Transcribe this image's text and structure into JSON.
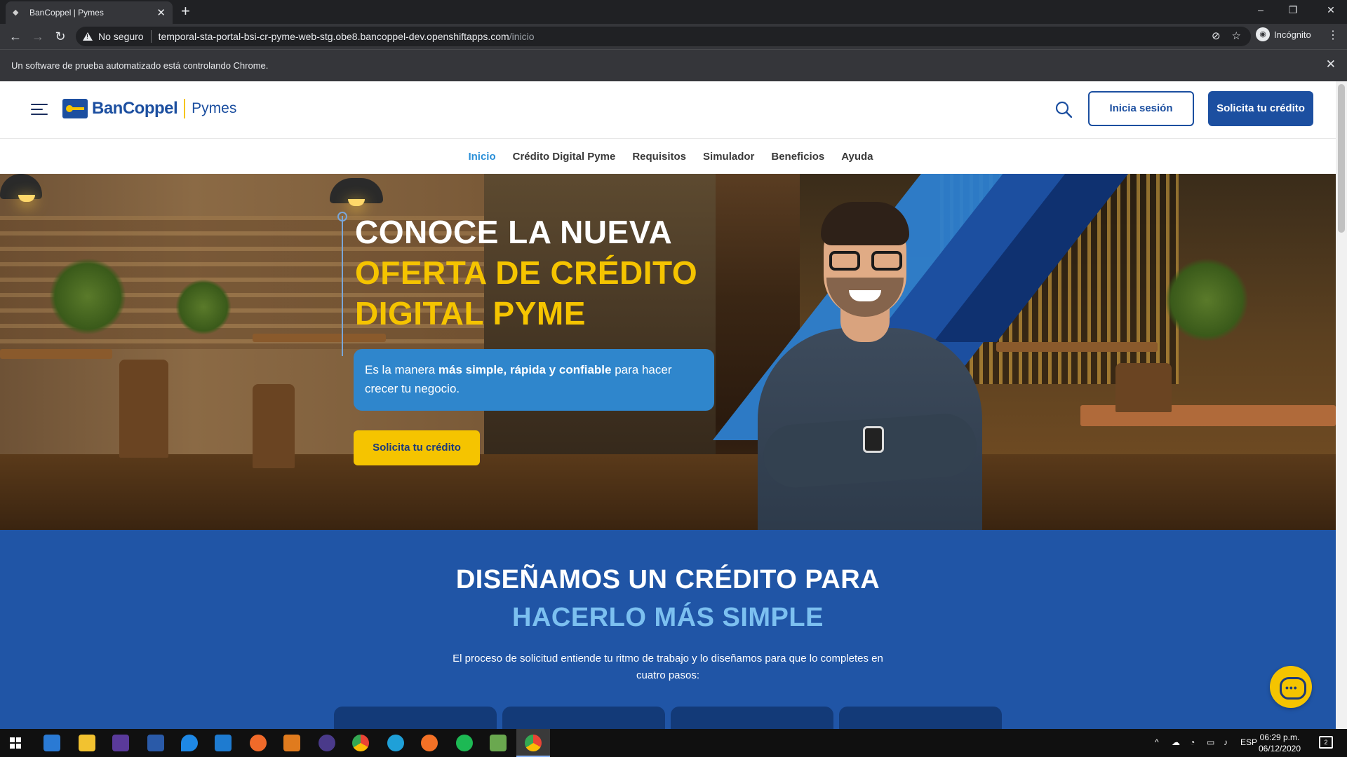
{
  "browser": {
    "tab_title": "BanCoppel | Pymes",
    "tab_close": "✕",
    "new_tab": "+",
    "security_label": "No seguro",
    "url_host": "temporal-sta-portal-bsi-cr-pyme-web-stg.obe8.bancoppel-dev.openshiftapps.com",
    "url_path": "/inicio",
    "profile_label": "Incógnito",
    "infobar_text": "Un software de prueba automatizado está controlando Chrome.",
    "infobar_close": "✕",
    "window_controls": [
      "–",
      "❐",
      "✕"
    ]
  },
  "site": {
    "brand": "BanCoppel",
    "brand_sub": "Pymes",
    "login_label": "Inicia sesión",
    "apply_label": "Solicita tu crédito",
    "nav": [
      {
        "label": "Inicio",
        "active": true
      },
      {
        "label": "Crédito Digital Pyme",
        "active": false
      },
      {
        "label": "Requisitos",
        "active": false
      },
      {
        "label": "Simulador",
        "active": false
      },
      {
        "label": "Beneficios",
        "active": false
      },
      {
        "label": "Ayuda",
        "active": false
      }
    ]
  },
  "hero": {
    "title_line1": "CONOCE LA NUEVA",
    "title_line2": "OFERTA DE CRÉDITO",
    "title_line3": "DIGITAL PYME",
    "box_pre": "Es la manera ",
    "box_bold": "más simple, rápida y confiable",
    "box_post": " para hacer crecer tu negocio.",
    "cta_label": "Solicita tu crédito"
  },
  "section2": {
    "heading_line1": "DISEÑAMOS UN CRÉDITO PARA",
    "heading_line2": "HACERLO MÁS SIMPLE",
    "description": "El proceso de solicitud entiende tu ritmo de trabajo y lo diseñamos para que lo completes en cuatro pasos:"
  },
  "taskbar": {
    "language": "ESP",
    "time": "06:29 p.m.",
    "date": "06/12/2020",
    "notification_count": "2"
  },
  "colors": {
    "brand_blue": "#1c4fa0",
    "brand_yellow": "#f5c400",
    "section_blue": "#2055a6",
    "nav_active": "#2a8fd8",
    "accent_lightblue": "#7cc0f0"
  },
  "icons": [
    "back-arrow-icon",
    "forward-arrow-icon",
    "reload-icon",
    "warning-icon",
    "eye-off-icon",
    "star-icon",
    "incognito-icon",
    "menu-icon",
    "search-icon",
    "chat-icon",
    "windows-start-icon"
  ]
}
